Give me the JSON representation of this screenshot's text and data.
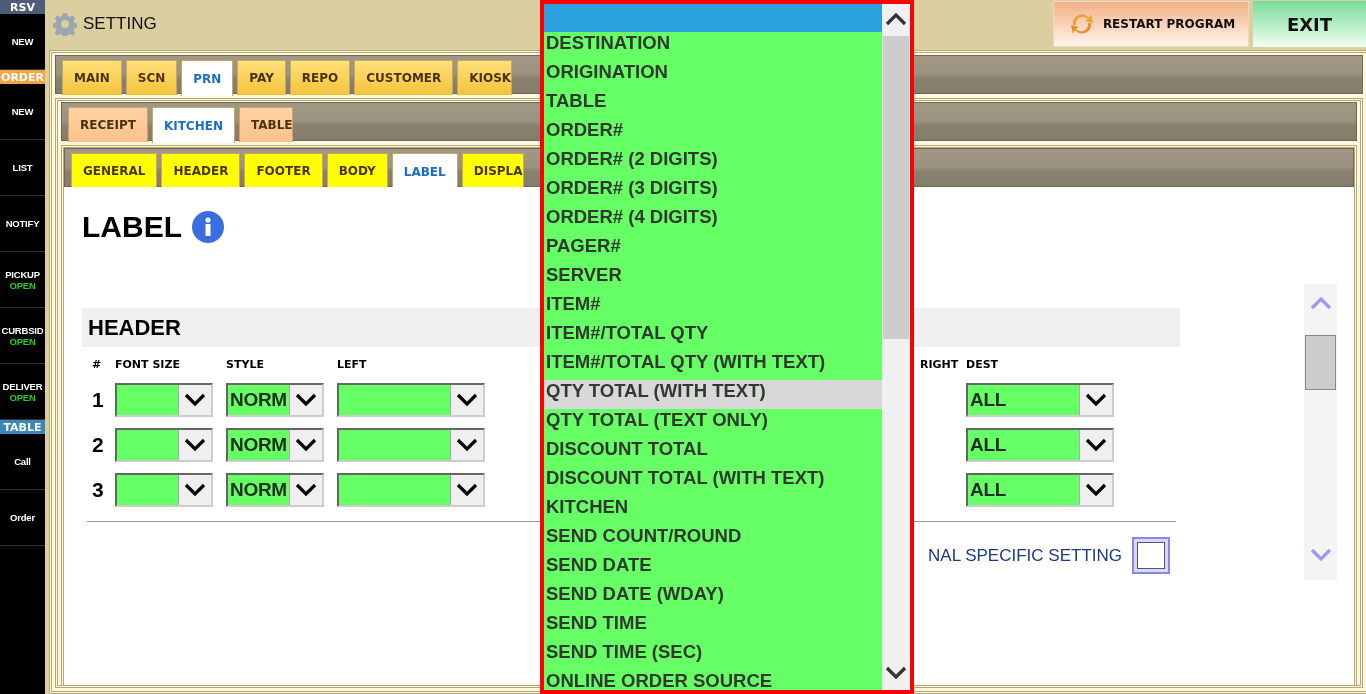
{
  "sidebar": {
    "items": [
      {
        "kind": "header",
        "label": "RSV",
        "color": "#4e5c7a"
      },
      {
        "kind": "button",
        "label": "NEW"
      },
      {
        "kind": "header",
        "label": "ORDER",
        "color": "#f4a444"
      },
      {
        "kind": "button",
        "label": "NEW"
      },
      {
        "kind": "button",
        "label": "LIST"
      },
      {
        "kind": "button",
        "label": "NOTIFY"
      },
      {
        "kind": "button",
        "label": "PICKUP",
        "status": "OPEN"
      },
      {
        "kind": "button",
        "label": "CURBSID",
        "status": "OPEN"
      },
      {
        "kind": "button",
        "label": "DELIVER",
        "status": "OPEN"
      },
      {
        "kind": "header",
        "label": "TABLE",
        "color": "#3a88b8"
      },
      {
        "kind": "button",
        "label": "Call"
      },
      {
        "kind": "button",
        "label": "Order"
      }
    ]
  },
  "header": {
    "title": "SETTING",
    "buttons": [
      {
        "kind": "restart",
        "label": "RESTART PROGRAM"
      },
      {
        "kind": "exit",
        "label": "EXIT"
      }
    ]
  },
  "main_tabs": [
    {
      "label": "MAIN",
      "selected": false
    },
    {
      "label": "SCN",
      "selected": false
    },
    {
      "label": "PRN",
      "selected": true
    },
    {
      "label": "PAY",
      "selected": false
    },
    {
      "label": "REPO",
      "selected": false
    },
    {
      "label": "CUSTOMER",
      "selected": false
    },
    {
      "label": "KIOSK",
      "selected": false
    }
  ],
  "sub_tabs": [
    {
      "label": "RECEIPT",
      "selected": false
    },
    {
      "label": "KITCHEN",
      "selected": true
    },
    {
      "label": "TABLE",
      "selected": false
    }
  ],
  "section_tabs": [
    {
      "label": "GENERAL",
      "selected": false
    },
    {
      "label": "HEADER",
      "selected": false
    },
    {
      "label": "FOOTER",
      "selected": false
    },
    {
      "label": "BODY",
      "selected": false
    },
    {
      "label": "LABEL",
      "selected": true
    },
    {
      "label": "DISPLA",
      "selected": false
    }
  ],
  "page": {
    "title": "LABEL",
    "section": "HEADER",
    "columns": [
      "#",
      "FONT SIZE",
      "STYLE",
      "LEFT",
      "RIGHT",
      "DEST"
    ],
    "rows": [
      {
        "number": "1",
        "style": "NORM",
        "dest": "ALL"
      },
      {
        "number": "2",
        "style": "NORM",
        "dest": "ALL"
      },
      {
        "number": "3",
        "style": "NORM",
        "dest": "ALL"
      }
    ],
    "option_label": "NAL SPECIFIC SETTING",
    "option_checked": false
  },
  "dropdown": {
    "blank_selected": true,
    "items": [
      {
        "label": "DESTINATION",
        "highlighted": false
      },
      {
        "label": "ORIGINATION",
        "highlighted": false
      },
      {
        "label": "TABLE",
        "highlighted": false
      },
      {
        "label": "ORDER#",
        "highlighted": false
      },
      {
        "label": "ORDER# (2 DIGITS)",
        "highlighted": false
      },
      {
        "label": "ORDER# (3 DIGITS)",
        "highlighted": false
      },
      {
        "label": "ORDER# (4 DIGITS)",
        "highlighted": false
      },
      {
        "label": "PAGER#",
        "highlighted": false
      },
      {
        "label": "SERVER",
        "highlighted": false
      },
      {
        "label": "ITEM#",
        "highlighted": false
      },
      {
        "label": "ITEM#/TOTAL QTY",
        "highlighted": false
      },
      {
        "label": "ITEM#/TOTAL QTY (WITH TEXT)",
        "highlighted": false
      },
      {
        "label": "QTY TOTAL (WITH TEXT)",
        "highlighted": true
      },
      {
        "label": "QTY TOTAL (TEXT ONLY)",
        "highlighted": false
      },
      {
        "label": "DISCOUNT TOTAL",
        "highlighted": false
      },
      {
        "label": "DISCOUNT TOTAL (WITH TEXT)",
        "highlighted": false
      },
      {
        "label": "KITCHEN",
        "highlighted": false
      },
      {
        "label": "SEND COUNT/ROUND",
        "highlighted": false
      },
      {
        "label": "SEND DATE",
        "highlighted": false
      },
      {
        "label": "SEND DATE (WDAY)",
        "highlighted": false
      },
      {
        "label": "SEND TIME",
        "highlighted": false
      },
      {
        "label": "SEND TIME (SEC)",
        "highlighted": false
      },
      {
        "label": "ONLINE ORDER SOURCE",
        "highlighted": false
      }
    ]
  }
}
